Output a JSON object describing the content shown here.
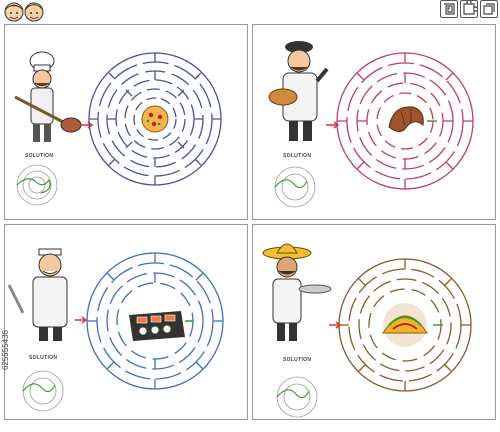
{
  "puzzles": [
    {
      "theme": "pizza",
      "maze_color": "#4a4fa8",
      "solution_color": "#4a9a3a",
      "solution_label": "SOLUTION",
      "character": "chef-icon",
      "goal": "pizza-icon"
    },
    {
      "theme": "croissant",
      "maze_color": "#c43a6a",
      "solution_color": "#4a9a3a",
      "solution_label": "SOLUTION",
      "character": "baker-icon",
      "goal": "croissant-icon"
    },
    {
      "theme": "sushi",
      "maze_color": "#3a6fc4",
      "solution_color": "#4a9a3a",
      "solution_label": "SOLUTION",
      "character": "sushi-chef-icon",
      "goal": "sushi-platter-icon"
    },
    {
      "theme": "taco",
      "maze_color": "#8a5a2a",
      "solution_color": "#4a9a3a",
      "solution_label": "SOLUTION",
      "character": "mexican-waiter-icon",
      "goal": "taco-icon"
    }
  ],
  "arrow_color": "#e03030",
  "watermark": "625555436"
}
